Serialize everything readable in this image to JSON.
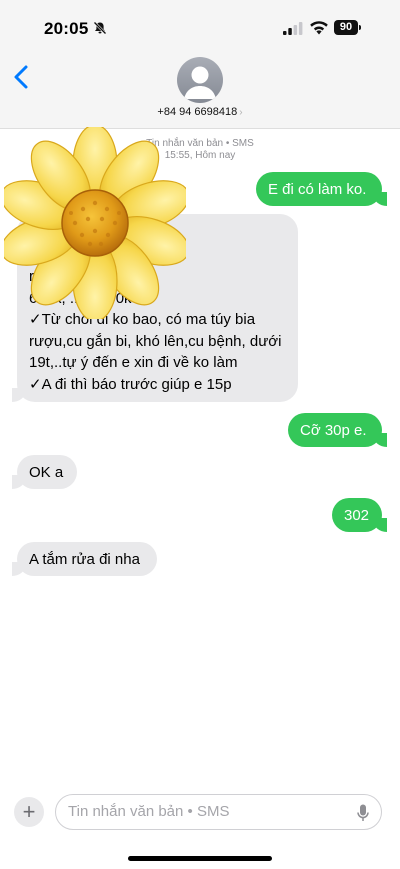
{
  "status_bar": {
    "time": "20:05",
    "battery": "90"
  },
  "header": {
    "contact": "+84 94 6698418",
    "chevron": "›"
  },
  "thread": {
    "meta_line1": "Tin nhắn văn bản • SMS",
    "meta_line2": "15:55, Hôm nay",
    "messages": [
      {
        "from": "me",
        "text": "E đi có làm ko."
      },
      {
        "from": "them",
        "text": "2, q10 _Yến\n\nrên bài Vân Anh\n600k, ...... 200k\n✓Từ chối đi ko bao, có ma túy bia rượu,cu gắn bi, khó lên,cu bệnh, dưới 19t,..tự ý đến e xin đi về ko làm\n✓A đi thì báo trước giúp e 15p"
      },
      {
        "from": "me",
        "text": "Cỡ 30p e."
      },
      {
        "from": "them",
        "text": "OK a"
      },
      {
        "from": "me",
        "text": "302"
      },
      {
        "from": "them",
        "text": "A tắm rửa đi nha"
      }
    ]
  },
  "compose": {
    "placeholder": "Tin nhắn văn bản • SMS",
    "plus": "+"
  },
  "icons": {
    "back": "chevron-left-icon",
    "avatar": "person-icon",
    "overlay": "sunflower-emoji",
    "mic": "microphone-icon",
    "bell": "bell-slash-icon"
  },
  "colors": {
    "outgoing": "#34c759",
    "incoming": "#e9e9eb",
    "accent": "#007aff"
  }
}
